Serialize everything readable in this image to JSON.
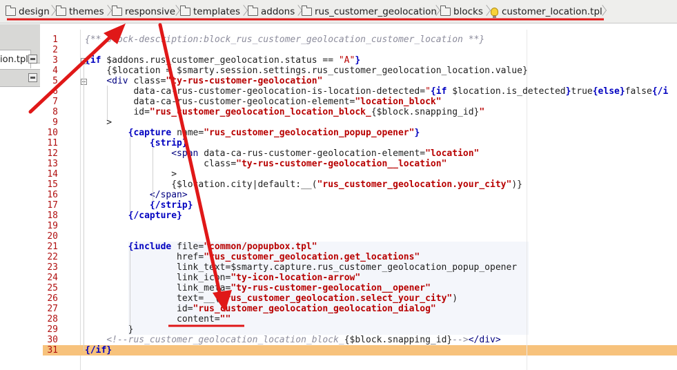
{
  "breadcrumb": {
    "items": [
      "design",
      "themes",
      "responsive",
      "templates",
      "addons",
      "rus_customer_geolocation",
      "blocks",
      "customer_location.tpl"
    ]
  },
  "left_panel": {
    "tab_label": "ion.tpl"
  },
  "editor": {
    "line_numbers": [
      "1",
      "2",
      "3",
      "4",
      "5",
      "6",
      "7",
      "8",
      "9",
      "10",
      "11",
      "12",
      "13",
      "14",
      "15",
      "16",
      "17",
      "18",
      "19",
      "20",
      "21",
      "22",
      "23",
      "24",
      "25",
      "26",
      "27",
      "28",
      "29",
      "30",
      "31"
    ],
    "lines": [
      [
        {
          "c": "c",
          "t": "{** block-description:block_rus_customer_geolocation_customer_location **}"
        }
      ],
      [],
      [
        {
          "c": "k",
          "t": "{if"
        },
        {
          "c": "",
          "t": " $addons.rus_customer_geolocation.status == "
        },
        {
          "c": "s",
          "t": "\"A\""
        },
        {
          "c": "k",
          "t": "}"
        }
      ],
      [
        {
          "c": "",
          "t": "    {$location = $smarty.session.settings.rus_customer_geolocation_location.value}"
        }
      ],
      [
        {
          "c": "",
          "t": "    "
        },
        {
          "c": "t",
          "t": "<div"
        },
        {
          "c": "",
          "t": " class="
        },
        {
          "c": "s b",
          "t": "\"ty-rus-customer-geolocation\""
        }
      ],
      [
        {
          "c": "",
          "t": "         data-ca-rus-customer-geolocation-is-location-detected="
        },
        {
          "c": "s",
          "t": "\""
        },
        {
          "c": "k",
          "t": "{if"
        },
        {
          "c": "",
          "t": " $location.is_detected"
        },
        {
          "c": "k",
          "t": "}"
        },
        {
          "c": "",
          "t": "true"
        },
        {
          "c": "k",
          "t": "{else}"
        },
        {
          "c": "",
          "t": "false"
        },
        {
          "c": "k",
          "t": "{/i"
        }
      ],
      [
        {
          "c": "",
          "t": "         data-ca-rus-customer-geolocation-element="
        },
        {
          "c": "s b",
          "t": "\"location_block\""
        }
      ],
      [
        {
          "c": "",
          "t": "         id="
        },
        {
          "c": "s b",
          "t": "\"rus_customer_geolocation_location_block_"
        },
        {
          "c": "",
          "t": "{$block.snapping_id}"
        },
        {
          "c": "s b",
          "t": "\""
        }
      ],
      [
        {
          "c": "",
          "t": "    >"
        }
      ],
      [
        {
          "c": "",
          "t": "        "
        },
        {
          "c": "k",
          "t": "{capture"
        },
        {
          "c": "",
          "t": " name="
        },
        {
          "c": "s b",
          "t": "\"rus_customer_geolocation_popup_opener\""
        },
        {
          "c": "k",
          "t": "}"
        }
      ],
      [
        {
          "c": "",
          "t": "            "
        },
        {
          "c": "k",
          "t": "{strip}"
        }
      ],
      [
        {
          "c": "",
          "t": "                "
        },
        {
          "c": "t",
          "t": "<span"
        },
        {
          "c": "",
          "t": " data-ca-rus-customer-geolocation-element="
        },
        {
          "c": "s b",
          "t": "\"location\""
        }
      ],
      [
        {
          "c": "",
          "t": "                      class="
        },
        {
          "c": "s b",
          "t": "\"ty-rus-customer-geolocation__location\""
        }
      ],
      [
        {
          "c": "",
          "t": "                >"
        }
      ],
      [
        {
          "c": "",
          "t": "                {$location.city|default:__("
        },
        {
          "c": "s b",
          "t": "\"rus_customer_geolocation.your_city\""
        },
        {
          "c": "",
          "t": ")}"
        }
      ],
      [
        {
          "c": "",
          "t": "            "
        },
        {
          "c": "t",
          "t": "</span>"
        }
      ],
      [
        {
          "c": "",
          "t": "            "
        },
        {
          "c": "k",
          "t": "{/strip}"
        }
      ],
      [
        {
          "c": "",
          "t": "        "
        },
        {
          "c": "k",
          "t": "{/capture}"
        }
      ],
      [],
      [],
      [
        {
          "c": "",
          "t": "        "
        },
        {
          "c": "k",
          "t": "{include"
        },
        {
          "c": "",
          "t": " file="
        },
        {
          "c": "s b",
          "t": "\"common/popupbox.tpl\""
        }
      ],
      [
        {
          "c": "",
          "t": "                 href="
        },
        {
          "c": "s b",
          "t": "\"rus_customer_geolocation.get_locations\""
        }
      ],
      [
        {
          "c": "",
          "t": "                 link_text=$smarty.capture.rus_customer_geolocation_popup_opener"
        }
      ],
      [
        {
          "c": "",
          "t": "                 link_icon="
        },
        {
          "c": "s b",
          "t": "\"ty-icon-location-arrow\""
        }
      ],
      [
        {
          "c": "",
          "t": "                 link_meta="
        },
        {
          "c": "s b",
          "t": "\"ty-rus-customer-geolocation__opener\""
        }
      ],
      [
        {
          "c": "",
          "t": "                 text=__("
        },
        {
          "c": "s b",
          "t": "\"rus_customer_geolocation.select_your_city\""
        },
        {
          "c": "",
          "t": ")"
        }
      ],
      [
        {
          "c": "",
          "t": "                 id="
        },
        {
          "c": "s b",
          "t": "\"rus_customer_geolocation_geolocation_dialog\""
        }
      ],
      [
        {
          "c": "",
          "t": "                 content="
        },
        {
          "c": "s b",
          "t": "\"\""
        }
      ],
      [
        {
          "c": "",
          "t": "        }"
        }
      ],
      [
        {
          "c": "",
          "t": "    "
        },
        {
          "c": "c",
          "t": "<!--rus_customer_geolocation_location_block_"
        },
        {
          "c": "",
          "t": "{$block.snapping_id}"
        },
        {
          "c": "c",
          "t": "-->"
        },
        {
          "c": "t",
          "t": "</div>"
        }
      ],
      [
        {
          "c": "k",
          "t": "{/if}"
        }
      ]
    ]
  },
  "colors": {
    "line_number": "#b01010",
    "keyword": "#0000c0",
    "string": "#b80000",
    "comment": "#8c8c9c",
    "current_line": "#f7c27c",
    "annotation_red": "#e01818"
  }
}
